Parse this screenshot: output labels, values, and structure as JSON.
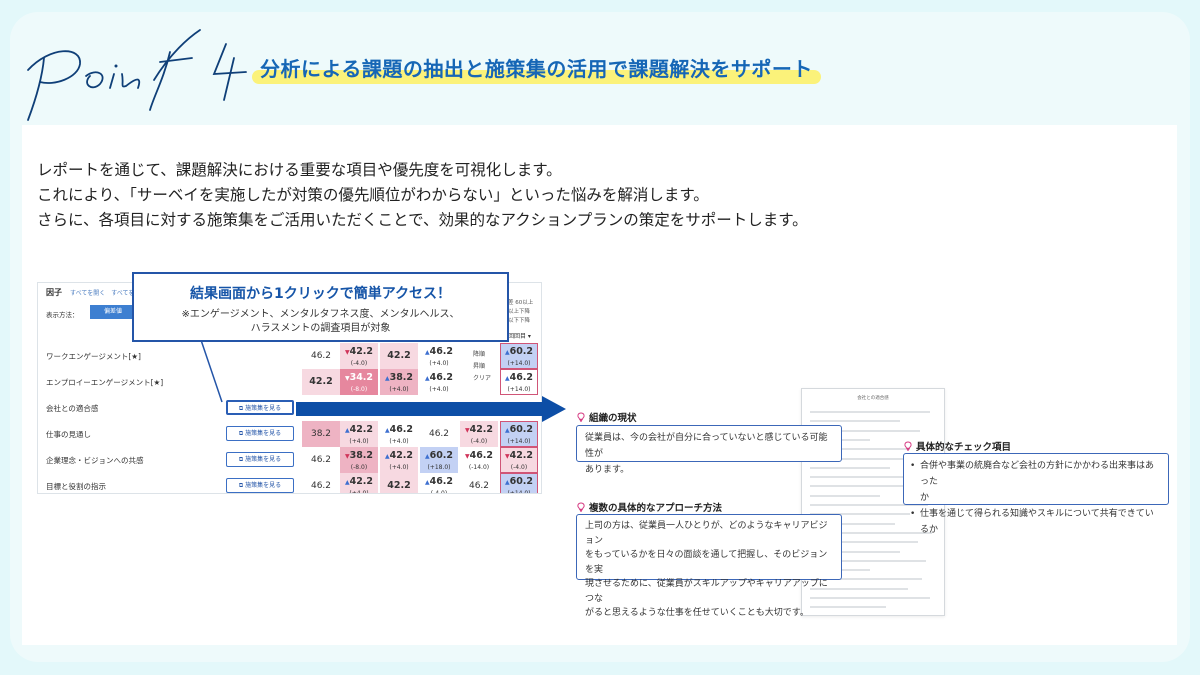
{
  "header": {
    "point_label": "Point 4",
    "title": "分析による課題の抽出と施策集の活用で課題解決をサポート"
  },
  "intro": {
    "line1": "レポートを通じて、課題解決における重要な項目や優先度を可視化します。",
    "line2": "これにより、「サーベイを実施したが対策の優先順位がわからない」といった悩みを解消します。",
    "line3": "さらに、各項目に対する施策集をご活用いただくことで、効果的なアクションプランの策定をサポートします。"
  },
  "table_screen": {
    "title": "因子",
    "links": "すべてを開く　すべてを閉",
    "mode_label": "表示方法：",
    "mode_value": "偏差値",
    "right_note": "差 60以上\n以上下降\n以下下降",
    "select_label": "回回目 ▾",
    "button_label": "施策集を見る",
    "rows": [
      {
        "label": "ワークエンゲージメント[★]",
        "show_button": false
      },
      {
        "label": "エンプロイーエンゲージメント[★]",
        "show_button": false
      },
      {
        "label": "会社との適合感",
        "show_button": true
      },
      {
        "label": "仕事の見通し",
        "show_button": true
      },
      {
        "label": "企業理念・ビジョンへの共感",
        "show_button": true
      },
      {
        "label": "目標と役割の指示",
        "show_button": true
      }
    ],
    "cells": [
      [
        {
          "v": "46.2"
        },
        {
          "v": "42.2",
          "d": "(-4.0)",
          "dir": "down",
          "bg": "pk1"
        },
        {
          "v": "42.2",
          "bg": "pk1",
          "bold": true
        },
        {
          "v": "46.2",
          "d": "(+4.0)",
          "dir": "up"
        },
        {
          "v": "",
          "bg": ""
        },
        {
          "v": "60.2",
          "d": "(+14.0)",
          "dir": "up",
          "bg": "bl2",
          "out": true
        }
      ],
      [
        {
          "v": "42.2",
          "bg": "pk1",
          "bold": true
        },
        {
          "v": "34.2",
          "d": "(-8.0)",
          "dir": "down",
          "bg": "pk3"
        },
        {
          "v": "38.2",
          "d": "(+4.0)",
          "dir": "up",
          "bg": "pk2"
        },
        {
          "v": "46.2",
          "d": "(+4.0)",
          "dir": "up"
        },
        {
          "v": "",
          "bg": ""
        },
        {
          "v": "46.2",
          "d": "(+14.0)",
          "dir": "up",
          "out": true
        }
      ],
      [],
      [
        {
          "v": "38.2",
          "bg": "pk2"
        },
        {
          "v": "42.2",
          "d": "(+4.0)",
          "dir": "up",
          "bg": "pk1"
        },
        {
          "v": "46.2",
          "d": "(+4.0)",
          "dir": "up"
        },
        {
          "v": "46.2"
        },
        {
          "v": "42.2",
          "d": "(-4.0)",
          "dir": "down",
          "bg": "pk1"
        },
        {
          "v": "60.2",
          "d": "(+14.0)",
          "dir": "up",
          "bg": "bl2",
          "out": true
        }
      ],
      [
        {
          "v": "46.2"
        },
        {
          "v": "38.2",
          "d": "(-8.0)",
          "dir": "down",
          "bg": "pk2"
        },
        {
          "v": "42.2",
          "d": "(+4.0)",
          "dir": "up",
          "bg": "pk1"
        },
        {
          "v": "60.2",
          "d": "(+18.0)",
          "dir": "up",
          "bg": "bl2"
        },
        {
          "v": "46.2",
          "d": "(-14.0)",
          "dir": "down"
        },
        {
          "v": "42.2",
          "d": "(-4.0)",
          "dir": "down",
          "bg": "pk1",
          "out": true
        }
      ],
      [
        {
          "v": "46.2"
        },
        {
          "v": "42.2",
          "d": "(+4.0)",
          "dir": "up",
          "bg": "pk1"
        },
        {
          "v": "42.2",
          "bg": "pk1",
          "bold": true
        },
        {
          "v": "46.2",
          "d": "(-4.0)",
          "dir": "up"
        },
        {
          "v": "46.2"
        },
        {
          "v": "60.2",
          "d": "(+14.0)",
          "dir": "up",
          "bg": "bl2",
          "out": true
        }
      ]
    ],
    "side_labels": [
      "降順",
      "昇順",
      "クリア"
    ]
  },
  "callout": {
    "title": "結果画面から1クリックで簡単アクセス！",
    "sub1": "※エンゲージメント、メンタルタフネス度、メンタルヘルス、",
    "sub2": "ハラスメントの調査項目が対象"
  },
  "document": {
    "title": "会社との適合感"
  },
  "bubbles": {
    "current_state": {
      "heading": "組織の現状",
      "body1": "従業員は、今の会社が自分に合っていないと感じている可能性が",
      "body2": "あります。"
    },
    "check_items": {
      "heading": "具体的なチェック項目",
      "item1": "合併や事業の統廃合など会社の方針にかかわる出来事はあった",
      "item1b": "か",
      "item2": "仕事を通じて得られる知識やスキルについて共有できているか"
    },
    "approach": {
      "heading": "複数の具体的なアプローチ方法",
      "l1": "上司の方は、従業員一人ひとりが、どのようなキャリアビジョン",
      "l2": "をもっているかを日々の面談を通して把握し、そのビジョンを実",
      "l3": "現させるために、従業員がスキルアップやキャリアアップにつな",
      "l4": "がると思えるような仕事を任せていくことも大切です。"
    }
  },
  "colors": {
    "accent": "#1666b6",
    "highlight": "#fbf27a",
    "arrow": "#0d4ea6",
    "bulb": "#d63c83"
  }
}
